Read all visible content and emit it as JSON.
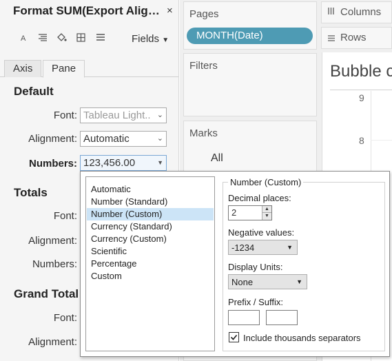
{
  "format_pane": {
    "title": "Format SUM(Export Alig…",
    "close_glyph": "×",
    "toolbar_icons": [
      "font-icon",
      "alignment-icon",
      "shading-icon",
      "borders-icon",
      "lines-icon"
    ],
    "fields_label": "Fields",
    "tabs": [
      "Axis",
      "Pane"
    ],
    "default": {
      "heading": "Default",
      "font_label": "Font:",
      "font_value": "Tableau Light..",
      "alignment_label": "Alignment:",
      "alignment_value": "Automatic",
      "numbers_label": "Numbers:",
      "numbers_value": "123,456.00"
    },
    "totals": {
      "heading": "Totals",
      "font_label": "Font:",
      "alignment_label": "Alignment:",
      "numbers_label": "Numbers:"
    },
    "grand_totals": {
      "heading": "Grand Total",
      "font_label": "Font:",
      "alignment_label": "Alignment:"
    }
  },
  "shelves": {
    "pages_title": "Pages",
    "pages_pill": "MONTH(Date)",
    "filters_title": "Filters",
    "marks_title": "Marks",
    "marks_all": "All",
    "columns_label": "Columns",
    "rows_label": "Rows"
  },
  "view": {
    "title": "Bubble c",
    "axis_ticks": [
      "9",
      "8"
    ]
  },
  "number_popup": {
    "formats": [
      "Automatic",
      "Number (Standard)",
      "Number (Custom)",
      "Currency (Standard)",
      "Currency (Custom)",
      "Scientific",
      "Percentage",
      "Custom"
    ],
    "selected_index": 2,
    "group_title": "Number (Custom)",
    "decimal_label": "Decimal places:",
    "decimal_value": "2",
    "negative_label": "Negative values:",
    "negative_value": "-1234",
    "units_label": "Display Units:",
    "units_value": "None",
    "prefix_suffix_label": "Prefix / Suffix:",
    "prefix_value": "",
    "suffix_value": "",
    "thousands_label": "Include thousands separators",
    "thousands_checked": true
  },
  "colors": {
    "pill": "#4e9bb4",
    "selection": "#cce4f7"
  }
}
